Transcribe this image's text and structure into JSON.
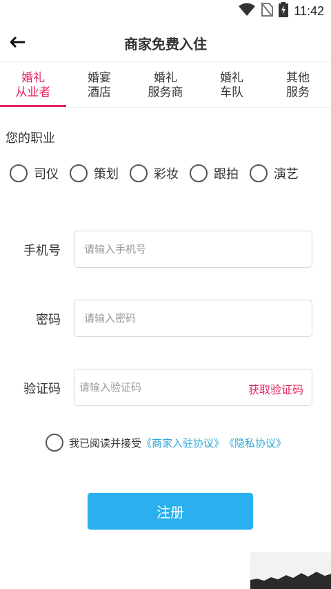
{
  "status_bar": {
    "time": "11:42",
    "icons": [
      "wifi-icon",
      "no-sim-icon",
      "battery-charging-icon"
    ]
  },
  "header": {
    "title": "商家免费入住",
    "back_icon": "arrow-left-icon"
  },
  "tabs": [
    {
      "line1": "婚礼",
      "line2": "从业者",
      "active": true
    },
    {
      "line1": "婚宴",
      "line2": "酒店",
      "active": false
    },
    {
      "line1": "婚礼",
      "line2": "服务商",
      "active": false
    },
    {
      "line1": "婚礼",
      "line2": "车队",
      "active": false
    },
    {
      "line1": "其他",
      "line2": "服务",
      "active": false
    }
  ],
  "profession": {
    "label": "您的职业",
    "options": [
      "司仪",
      "策划",
      "彩妆",
      "跟拍",
      "演艺"
    ]
  },
  "form": {
    "phone": {
      "label": "手机号",
      "value": "",
      "placeholder": "请输入手机号"
    },
    "password": {
      "label": "密码",
      "value": "",
      "placeholder": "请输入密码"
    },
    "code": {
      "label": "验证码",
      "value": "",
      "placeholder": "请输入验证码",
      "action": "获取验证码"
    }
  },
  "agreement": {
    "text": "我已阅读并接受",
    "link1": "《商家入驻协议》",
    "link2": "《隐私协议》"
  },
  "register": {
    "label": "注册"
  },
  "colors": {
    "accent_pink": "#e6245e",
    "button_blue": "#2ab0ee",
    "link_blue": "#2aa6d8"
  }
}
